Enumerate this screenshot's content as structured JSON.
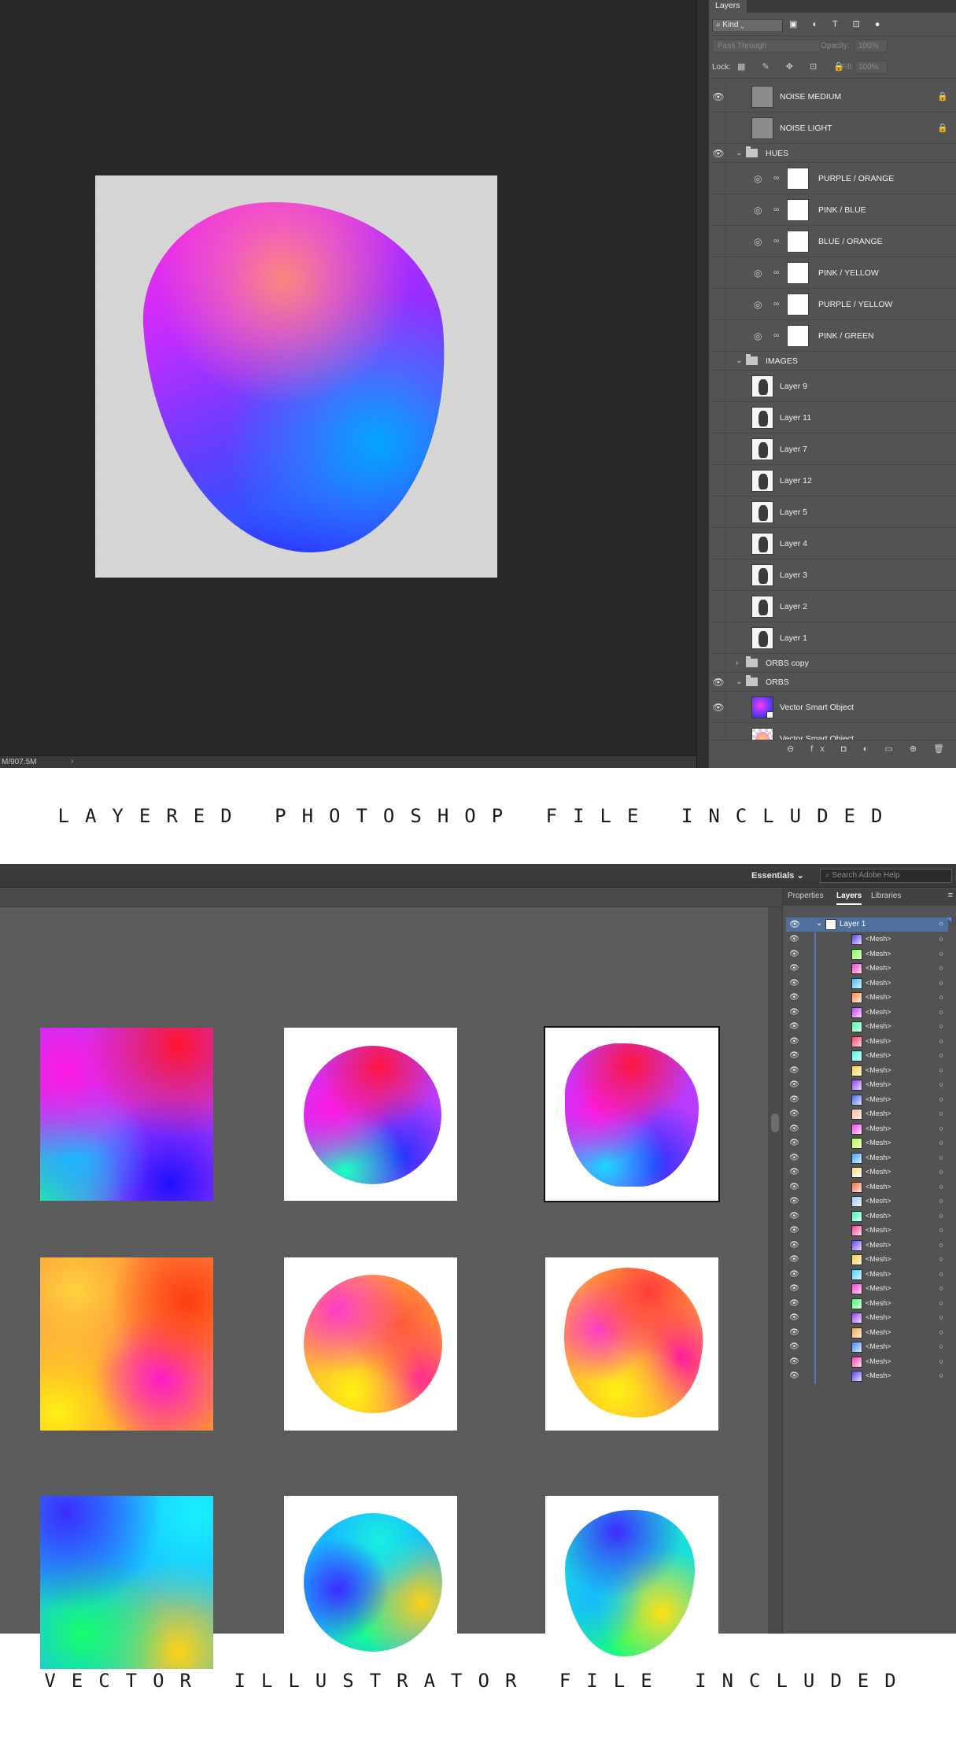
{
  "photoshop": {
    "panel_tab": "Layers",
    "filter_kind": "Kind",
    "filter_icons": "▣ ◐ T ⊡ ●",
    "blend_mode": "Pass Through",
    "opacity_label": "Opacity:",
    "opacity_value": "100%",
    "lock_label": "Lock:",
    "lock_icons": "▦ ✎ ✥ ⊡ 🔒",
    "fill_label": "Fill:",
    "fill_value": "100%",
    "status_text": "M/907.5M",
    "status_arrow": "›",
    "layers": [
      {
        "kind": "pixel",
        "name": "NOISE MEDIUM",
        "visible": true,
        "locked": true,
        "thumb": "grey"
      },
      {
        "kind": "pixel",
        "name": "NOISE LIGHT",
        "visible": false,
        "locked": true,
        "thumb": "grey"
      },
      {
        "kind": "group",
        "name": "HUES",
        "visible": true,
        "expanded": true
      },
      {
        "kind": "adjust",
        "name": "PURPLE / ORANGE",
        "visible": false
      },
      {
        "kind": "adjust",
        "name": "PINK /  BLUE",
        "visible": false
      },
      {
        "kind": "adjust",
        "name": "BLUE / ORANGE",
        "visible": false
      },
      {
        "kind": "adjust",
        "name": "PINK / YELLOW",
        "visible": false
      },
      {
        "kind": "adjust",
        "name": "PURPLE / YELLOW",
        "visible": false
      },
      {
        "kind": "adjust",
        "name": "PINK / GREEN",
        "visible": false
      },
      {
        "kind": "group",
        "name": "IMAGES",
        "visible": false,
        "expanded": true
      },
      {
        "kind": "pixel",
        "name": "Layer 9",
        "visible": false,
        "thumb": "photo"
      },
      {
        "kind": "pixel",
        "name": "Layer 11",
        "visible": false,
        "thumb": "photo"
      },
      {
        "kind": "pixel",
        "name": "Layer 7",
        "visible": false,
        "thumb": "photo"
      },
      {
        "kind": "pixel",
        "name": "Layer 12",
        "visible": false,
        "thumb": "photo"
      },
      {
        "kind": "pixel",
        "name": "Layer 5",
        "visible": false,
        "thumb": "photo"
      },
      {
        "kind": "pixel",
        "name": "Layer 4",
        "visible": false,
        "thumb": "photo"
      },
      {
        "kind": "pixel",
        "name": "Layer 3",
        "visible": false,
        "thumb": "photo"
      },
      {
        "kind": "pixel",
        "name": "Layer 2",
        "visible": false,
        "thumb": "photo"
      },
      {
        "kind": "pixel",
        "name": "Layer 1",
        "visible": false,
        "thumb": "photo"
      },
      {
        "kind": "group",
        "name": "ORBS copy",
        "visible": false,
        "expanded": false
      },
      {
        "kind": "group",
        "name": "ORBS",
        "visible": true,
        "expanded": true
      },
      {
        "kind": "smart",
        "name": "Vector Smart Object",
        "visible": true,
        "thumb": "orb1"
      },
      {
        "kind": "smart",
        "name": "Vector Smart Object",
        "visible": false,
        "thumb": "orb2"
      }
    ],
    "footer_icons": "⊖ fx ◘ ◐ ▭ ⊕ 🗑"
  },
  "captions": {
    "photoshop": "LAYERED PHOTOSHOP FILE INCLUDED",
    "illustrator": "VECTOR ILLUSTRATOR FILE INCLUDED"
  },
  "illustrator": {
    "workspace": "Essentials ⌄",
    "search_placeholder": "⌕ Search Adobe Help",
    "tabs": [
      "Properties",
      "Layers",
      "Libraries"
    ],
    "active_tab": "Layers",
    "panel_menu_icon": "≡",
    "top_layer": "Layer 1",
    "sublayer_name": "<Mesh>",
    "sublayer_count": 31,
    "sublayer_colors": [
      "#5b3cff",
      "#7cff3c",
      "#ff3cc8",
      "#3cbcff",
      "#ff8a3c",
      "#c83cff",
      "#3cff9c",
      "#ff3c6a",
      "#3cffe0",
      "#ffd23c",
      "#8a3cff",
      "#3c6aff",
      "#ffb8a0",
      "#ff3cf0",
      "#b0ff3c",
      "#3ca0ff",
      "#ffe08a",
      "#ff6a3c",
      "#a0c8ff",
      "#3cffb8",
      "#ff3c9c",
      "#6a3cff",
      "#ffc83c",
      "#3cd2ff",
      "#ff3cd2",
      "#3cff6a",
      "#9c3cff",
      "#ffa03c",
      "#3c8aff",
      "#ff3cb0",
      "#5a3cff"
    ]
  }
}
